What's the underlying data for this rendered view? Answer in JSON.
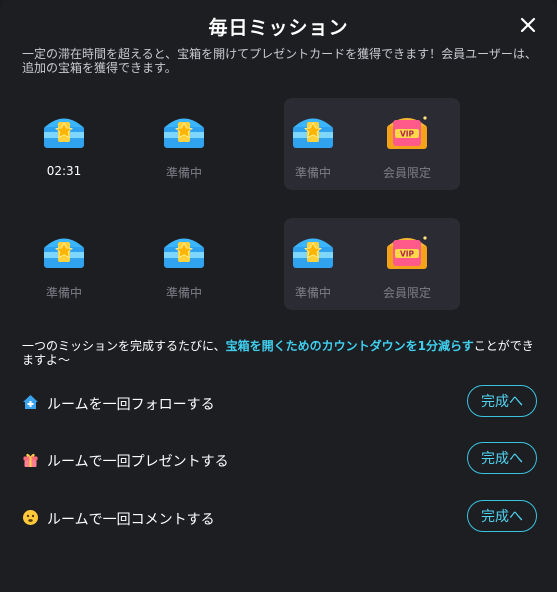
{
  "dialog": {
    "title": "毎日ミッション",
    "close_icon": "close-icon",
    "intro": "一定の滞在時間を超えると、宝箱を開けてプレゼントカードを獲得できます！会員ユーザーは、追加の宝箱を獲得できます。"
  },
  "chests": {
    "row1": [
      {
        "label": "02:31",
        "type": "normal",
        "active": true
      },
      {
        "label": "準備中",
        "type": "normal"
      },
      {
        "label": "準備中",
        "type": "normal"
      },
      {
        "label": "会員限定",
        "type": "vip"
      }
    ],
    "row2": [
      {
        "label": "準備中",
        "type": "normal"
      },
      {
        "label": "準備中",
        "type": "normal"
      },
      {
        "label": "準備中",
        "type": "normal"
      },
      {
        "label": "会員限定",
        "type": "vip"
      }
    ],
    "vip_badge": "VIP"
  },
  "tip": {
    "before": "一つのミッションを完成するたびに、",
    "highlight": "宝箱を開くためのカウントダウンを1分減らす",
    "after": "ことができますよ～"
  },
  "missions": [
    {
      "icon": "follow-home-icon",
      "text": "ルームを一回フォローする",
      "button": "完成へ"
    },
    {
      "icon": "gift-icon",
      "text": "ルームで一回プレゼントする",
      "button": "完成へ"
    },
    {
      "icon": "comment-emoji-icon",
      "text": "ルームで一回コメントする",
      "button": "完成へ"
    }
  ],
  "colors": {
    "accent": "#3ac2e0",
    "background": "#1d1e22",
    "vip_panel": "#2b2c33"
  }
}
